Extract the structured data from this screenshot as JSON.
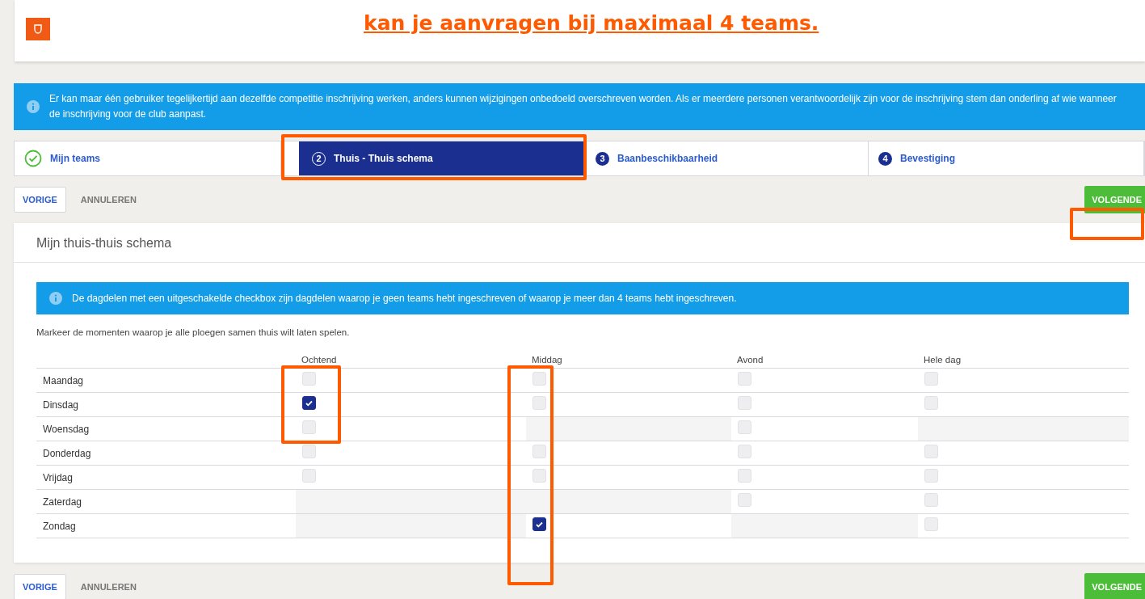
{
  "header": {
    "headline": "kan je aanvragen bij maximaal 4 teams."
  },
  "notice": "Er kan maar één gebruiker tegelijkertijd aan dezelfde competitie inschrijving werken, anders kunnen wijzigingen onbedoeld overschreven worden. Als er meerdere personen verantwoordelijk zijn voor de inschrijving stem dan onderling af wie wanneer de inschrijving voor de club aanpast.",
  "steps": [
    {
      "label": "Mijn teams",
      "done": true,
      "selected": false
    },
    {
      "number": "2",
      "label": "Thuis - Thuis schema",
      "done": false,
      "selected": true
    },
    {
      "number": "3",
      "label": "Baanbeschikbaarheid",
      "done": false,
      "selected": false
    },
    {
      "number": "4",
      "label": "Bevestiging",
      "done": false,
      "selected": false
    }
  ],
  "nav_top": {
    "back": "VORIGE",
    "cancel": "ANNULEREN",
    "next": "VOLGENDE"
  },
  "panel": {
    "title": "Mijn thuis-thuis schema",
    "info": "De dagdelen met een uitgeschakelde checkbox zijn dagdelen waarop je geen teams hebt ingeschreven of waarop je meer dan 4 teams hebt ingeschreven.",
    "instruction": "Markeer de momenten waarop je alle ploegen samen thuis wilt laten spelen.",
    "columns": [
      "Ochtend",
      "Middag",
      "Avond",
      "Hele dag"
    ],
    "rows": [
      {
        "day": "Maandag",
        "cells": [
          {
            "kind": "checkbox",
            "checked": false
          },
          {
            "kind": "checkbox",
            "checked": false
          },
          {
            "kind": "checkbox",
            "checked": false
          },
          {
            "kind": "checkbox",
            "checked": false
          }
        ]
      },
      {
        "day": "Dinsdag",
        "cells": [
          {
            "kind": "checkbox",
            "checked": true
          },
          {
            "kind": "checkbox",
            "checked": false
          },
          {
            "kind": "checkbox",
            "checked": false
          },
          {
            "kind": "checkbox",
            "checked": false
          }
        ]
      },
      {
        "day": "Woensdag",
        "cells": [
          {
            "kind": "checkbox",
            "checked": false
          },
          {
            "kind": "unavailable"
          },
          {
            "kind": "checkbox",
            "checked": false
          },
          {
            "kind": "unavailable"
          }
        ]
      },
      {
        "day": "Donderdag",
        "cells": [
          {
            "kind": "checkbox",
            "checked": false
          },
          {
            "kind": "checkbox",
            "checked": false
          },
          {
            "kind": "checkbox",
            "checked": false
          },
          {
            "kind": "checkbox",
            "checked": false
          }
        ]
      },
      {
        "day": "Vrijdag",
        "cells": [
          {
            "kind": "checkbox",
            "checked": false
          },
          {
            "kind": "checkbox",
            "checked": false
          },
          {
            "kind": "checkbox",
            "checked": false
          },
          {
            "kind": "checkbox",
            "checked": false
          }
        ]
      },
      {
        "day": "Zaterdag",
        "cells": [
          {
            "kind": "unavailable"
          },
          {
            "kind": "unavailable"
          },
          {
            "kind": "checkbox",
            "checked": false
          },
          {
            "kind": "checkbox",
            "checked": false
          }
        ]
      },
      {
        "day": "Zondag",
        "cells": [
          {
            "kind": "unavailable"
          },
          {
            "kind": "checkbox",
            "checked": true
          },
          {
            "kind": "unavailable"
          },
          {
            "kind": "checkbox",
            "checked": false
          }
        ]
      }
    ]
  },
  "nav_bottom": {
    "back": "VORIGE",
    "cancel": "ANNULEREN",
    "next": "VOLGENDE"
  }
}
